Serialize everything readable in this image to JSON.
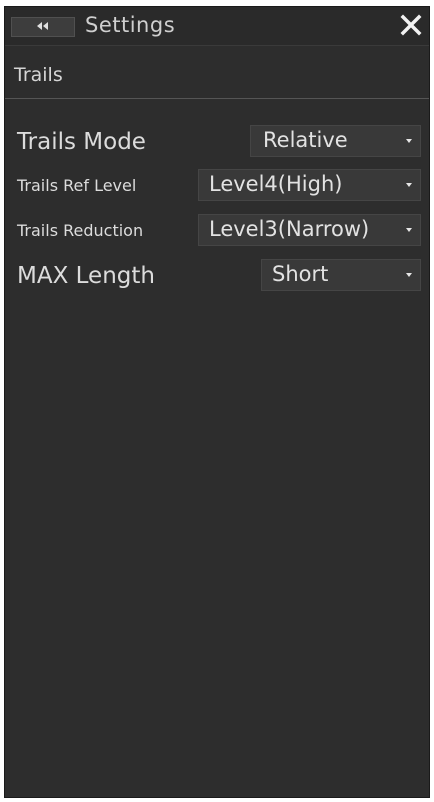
{
  "window": {
    "title": "Settings",
    "back_icon": "double-chevron-left-icon",
    "close_icon": "close-icon"
  },
  "section": {
    "title": "Trails"
  },
  "settings": [
    {
      "label": "Trails Mode",
      "value": "Relative"
    },
    {
      "label": "Trails Ref Level",
      "value": "Level4(High)"
    },
    {
      "label": "Trails Reduction",
      "value": "Level3(Narrow)"
    },
    {
      "label": "MAX Length",
      "value": "Short"
    }
  ],
  "colors": {
    "panel_bg": "#2d2d2d",
    "select_bg": "#393939",
    "text": "#dcdcdc"
  }
}
